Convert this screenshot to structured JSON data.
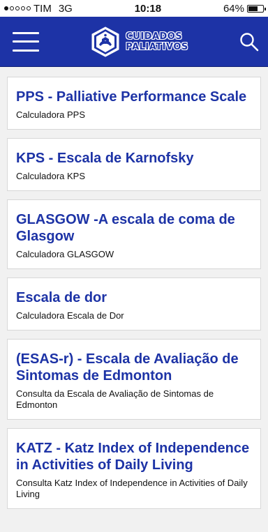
{
  "status_bar": {
    "carrier": "TIM",
    "network": "3G",
    "time": "10:18",
    "battery": "64%"
  },
  "header": {
    "logo_line1": "CUIDADOS",
    "logo_line2": "PALIATIVOS",
    "menu_icon": "hamburger-menu-icon",
    "search_icon": "search-icon",
    "brand_color": "#1d33a6"
  },
  "items": [
    {
      "title": "PPS - Palliative Performance Scale",
      "subtitle": "Calculadora PPS"
    },
    {
      "title": "KPS - Escala de Karnofsky",
      "subtitle": "Calculadora KPS"
    },
    {
      "title": "GLASGOW -A escala de coma de Glasgow",
      "subtitle": "Calculadora GLASGOW"
    },
    {
      "title": "Escala de dor",
      "subtitle": "Calculadora Escala de Dor"
    },
    {
      "title": "(ESAS-r) - Escala de Avaliação de Sintomas de Edmonton",
      "subtitle": "Consulta da Escala de Avaliação de Sintomas de Edmonton"
    },
    {
      "title": "KATZ - Katz Index of Independence in Activities of Daily Living",
      "subtitle": "Consulta Katz Index of Independence in Activities of Daily Living"
    }
  ]
}
